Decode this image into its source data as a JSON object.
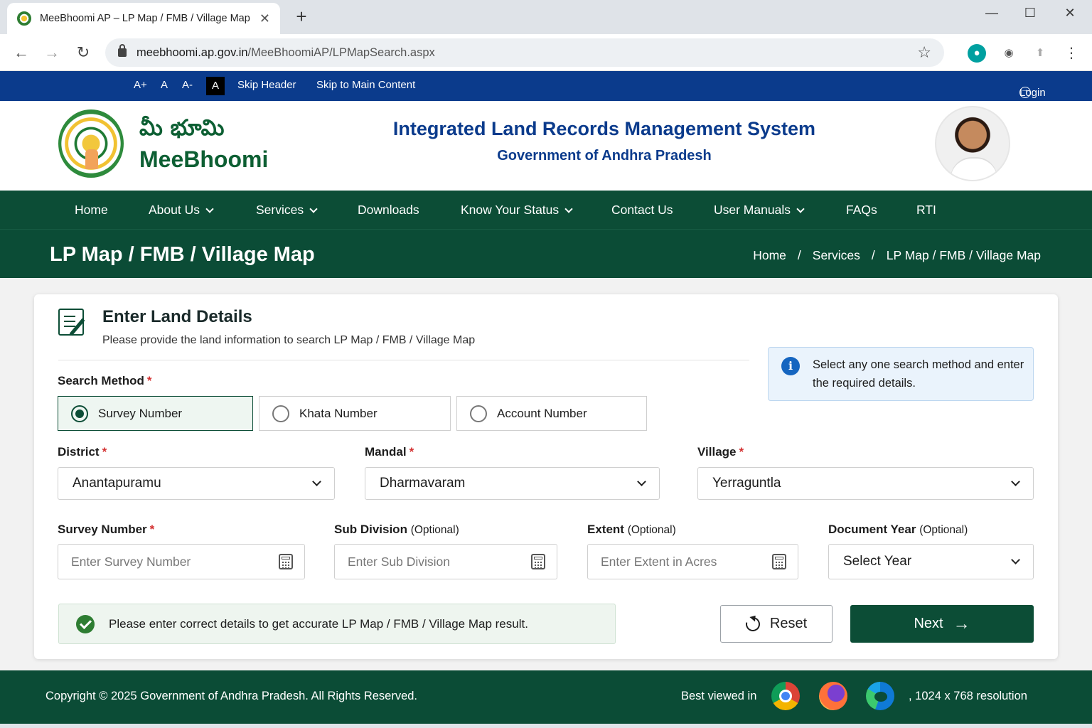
{
  "browser": {
    "tab_title": "MeeBhoomi AP – LP Map / FMB / Village Map",
    "tab_close": "✕",
    "new_tab": "+",
    "url_host": "meebhoomi.ap.gov.in",
    "url_path": "/MeeBhoomiAP/LPMapSearch.aspx"
  },
  "access_bar": {
    "font_increase": "A+",
    "font_normal": "A",
    "font_decrease": "A-",
    "contrast": "A",
    "skip_header": "Skip Header",
    "skip_main": "Skip to Main Content",
    "login": "Login"
  },
  "header": {
    "logo_telugu": "మీ భూమి",
    "logo_text": "MeeBhoomi",
    "title": "Integrated Land Records Management System",
    "subtitle": "Government of Andhra Pradesh"
  },
  "nav": {
    "items": [
      {
        "label": "Home",
        "dropdown": false
      },
      {
        "label": "About Us",
        "dropdown": true
      },
      {
        "label": "Services",
        "dropdown": true
      },
      {
        "label": "Downloads",
        "dropdown": false
      },
      {
        "label": "Know Your Status",
        "dropdown": true
      },
      {
        "label": "Contact Us",
        "dropdown": false
      },
      {
        "label": "User Manuals",
        "dropdown": true
      },
      {
        "label": "FAQs",
        "dropdown": false
      },
      {
        "label": "RTI",
        "dropdown": false
      }
    ]
  },
  "page": {
    "title": "LP Map / FMB / Village Map",
    "breadcrumb": [
      "Home",
      "Services",
      "LP Map / FMB / Village Map"
    ],
    "breadcrumb_sep": "/"
  },
  "form": {
    "card_title": "Enter Land Details",
    "card_subtitle": "Please provide the land information to search LP Map / FMB / Village Map",
    "info": "Select any one search method and enter the required details.",
    "search_method_label": "Search Method",
    "required_mark": "*",
    "search_methods": [
      "Survey Number",
      "Khata Number",
      "Account Number"
    ],
    "selected_method": "Survey Number",
    "district": {
      "label": "District",
      "value": "Anantapuramu"
    },
    "mandal": {
      "label": "Mandal",
      "value": "Dharmavaram"
    },
    "village": {
      "label": "Village",
      "value": "Yerraguntla"
    },
    "survey_number": {
      "label": "Survey Number",
      "placeholder": "Enter Survey Number"
    },
    "sub_division": {
      "label": "Sub Division",
      "optional": "(Optional)",
      "placeholder": "Enter Sub Division"
    },
    "extent": {
      "label": "Extent",
      "optional": "(Optional)",
      "placeholder": "Enter Extent in Acres"
    },
    "document_year": {
      "label": "Document Year",
      "optional": "(Optional)",
      "value": "Select Year"
    },
    "notice": "Please enter correct details to get accurate LP Map / FMB / Village Map result.",
    "reset_label": "Reset",
    "next_label": "Next"
  },
  "footer": {
    "copyright": "Copyright © 2025 Government of Andhra Pradesh. All Rights Reserved.",
    "best_viewed": "Best viewed in",
    "resolution": ",  1024 x 768 resolution"
  },
  "colors": {
    "primary_green": "#0c4d36",
    "access_blue": "#0b3b8c",
    "required_red": "#d32f2f"
  }
}
